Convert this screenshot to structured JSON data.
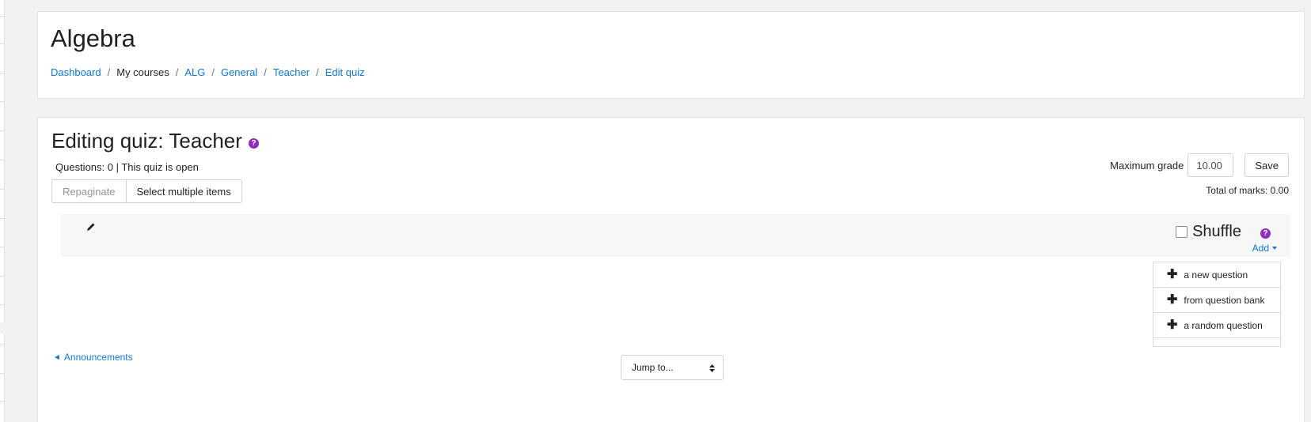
{
  "header": {
    "title": "Algebra",
    "breadcrumb": [
      {
        "label": "Dashboard"
      },
      {
        "label": "My courses"
      },
      {
        "label": "ALG"
      },
      {
        "label": "General"
      },
      {
        "label": "Teacher"
      },
      {
        "label": "Edit quiz"
      }
    ],
    "separator": "/"
  },
  "quiz": {
    "title": "Editing quiz: Teacher",
    "status": "Questions: 0 | This quiz is open",
    "repaginate_label": "Repaginate",
    "select_multiple_label": "Select multiple items",
    "max_grade_label": "Maximum grade",
    "max_grade_value": "10.00",
    "save_label": "Save",
    "total_marks": "Total of marks: 0.00"
  },
  "section": {
    "shuffle_label": "Shuffle",
    "shuffle_checked": false,
    "add_label": "Add"
  },
  "add_menu": {
    "items": [
      {
        "label": "a new question"
      },
      {
        "label": "from question bank"
      },
      {
        "label": "a random question"
      }
    ]
  },
  "footer": {
    "prev_link": "Announcements",
    "prev_arrow": "◄",
    "jump_placeholder": "Jump to..."
  },
  "icons": {
    "help": "help-icon",
    "edit": "pencil-icon",
    "add": "plus-icon"
  },
  "colors": {
    "link": "#1177d1",
    "help_icon": "#8f2bbd",
    "background": "#f2f2f2"
  }
}
